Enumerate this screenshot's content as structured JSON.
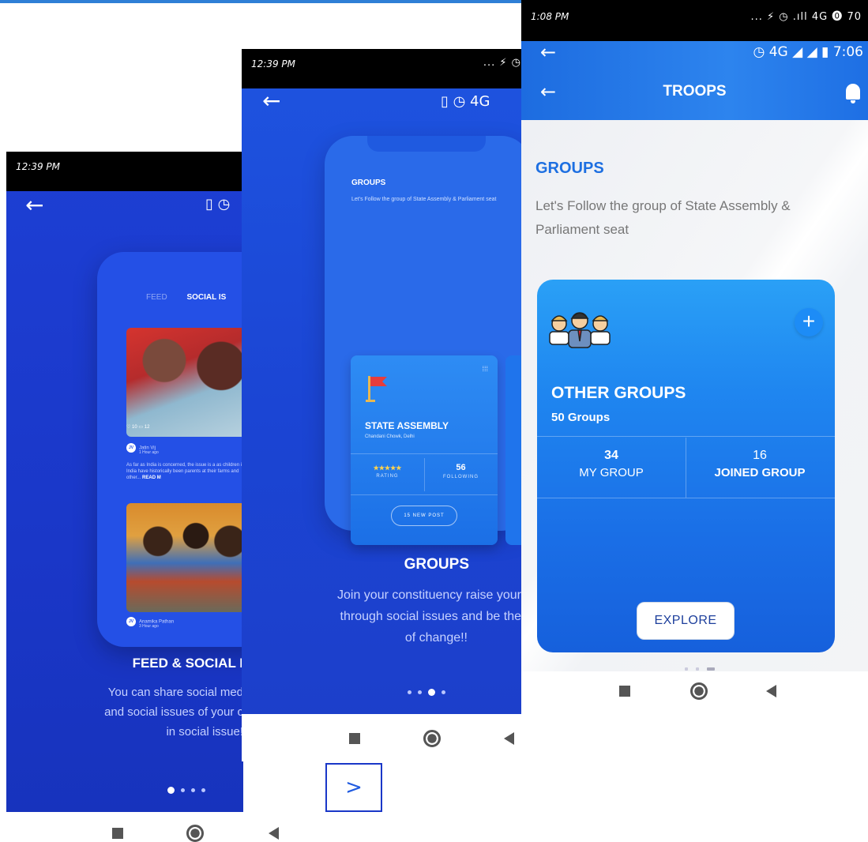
{
  "screen1": {
    "status_time": "12:39 PM",
    "tabs": [
      "FEED",
      "SOCIAL IS"
    ],
    "posts": [
      {
        "initials": "JV",
        "author": "Jatin Vij",
        "ago": "1 Hour ago",
        "likes": "10",
        "comments": "12",
        "text": "As far as India is concerned, the issue is a as children in India have historically been parents at their farms and other...",
        "read_more": "READ M"
      },
      {
        "initials": "JV",
        "author": "Anamika Pathan",
        "ago": "3 Hour ago"
      }
    ],
    "title": "FEED & SOCIAL I",
    "body": [
      "You can share social med",
      "and social issues of your c",
      "in social issue!"
    ],
    "next_label": ">"
  },
  "screen2": {
    "status_time": "12:39 PM",
    "mock_title": "GROUPS",
    "mock_sub": "Let's Follow the group of State Assembly & Parliament seat",
    "card": {
      "title": "STATE ASSEMBLY",
      "subtitle": "Chandani Chowk, Delhi",
      "stars": "★★★★★",
      "rating_label": "RATING",
      "following_value": "56",
      "following_label": "FOLLOWING",
      "pill": "15 NEW POST"
    },
    "title": "GROUPS",
    "body": [
      "Join your constituency raise your",
      "through social issues and be the",
      "of change!!"
    ]
  },
  "screen3": {
    "status_time": "1:08 PM",
    "status_right": "... ⚡ ◷ .ıll 4G ⓿ 70",
    "sys_right": "◷ 4G ◢ ◢ ▮ 7:06",
    "header_title": "TROOPS",
    "heading": "GROUPS",
    "description": "Let's Follow the group of State Assembly & Parliament seat",
    "card": {
      "title": "OTHER GROUPS",
      "subtitle": "50 Groups",
      "my_group_value": "34",
      "my_group_label": "MY GROUP",
      "joined_value": "16",
      "joined_label": "JOINED GROUP",
      "explore": "EXPLORE"
    }
  }
}
